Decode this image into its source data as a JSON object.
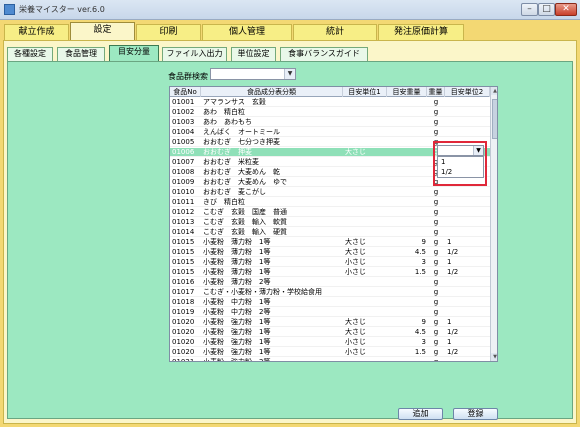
{
  "window": {
    "title": "栄養マイスター ver.6.0"
  },
  "main_tabs": [
    "献立作成",
    "設定",
    "印刷",
    "個人管理",
    "統計",
    "発注原価計算"
  ],
  "sub_tabs": [
    "各種設定",
    "食品管理",
    "目安分量",
    "ファイル入出力",
    "単位設定",
    "食事バランスガイド"
  ],
  "search": {
    "label": "食品群検索",
    "value": ""
  },
  "table": {
    "headers": [
      "食品No",
      "食品成分表分類",
      "目安単位1",
      "目安重量",
      "重量",
      "目安単位2"
    ],
    "rows": [
      {
        "no": "01001",
        "name": "アマランサス　玄穀",
        "u1": "",
        "q": "",
        "w": "g",
        "u2": ""
      },
      {
        "no": "01002",
        "name": "あわ　精白粒",
        "u1": "",
        "q": "",
        "w": "g",
        "u2": ""
      },
      {
        "no": "01003",
        "name": "あわ　あわもち",
        "u1": "",
        "q": "",
        "w": "g",
        "u2": ""
      },
      {
        "no": "01004",
        "name": "えんばく　オートミール",
        "u1": "",
        "q": "",
        "w": "g",
        "u2": ""
      },
      {
        "no": "01005",
        "name": "おおむぎ　七分つき押麦",
        "u1": "",
        "q": "",
        "w": "g",
        "u2": ""
      },
      {
        "no": "01006",
        "name": "おおむぎ　押麦",
        "u1": "大さじ",
        "q": "",
        "w": "g",
        "u2": "",
        "selected": true
      },
      {
        "no": "01007",
        "name": "おおむぎ　米粒麦",
        "u1": "",
        "q": "",
        "w": "g",
        "u2": ""
      },
      {
        "no": "01008",
        "name": "おおむぎ　大麦めん　乾",
        "u1": "",
        "q": "",
        "w": "g",
        "u2": ""
      },
      {
        "no": "01009",
        "name": "おおむぎ　大麦めん　ゆで",
        "u1": "",
        "q": "",
        "w": "g",
        "u2": ""
      },
      {
        "no": "01010",
        "name": "おおむぎ　麦こがし",
        "u1": "",
        "q": "",
        "w": "g",
        "u2": ""
      },
      {
        "no": "01011",
        "name": "きび　精白粒",
        "u1": "",
        "q": "",
        "w": "g",
        "u2": ""
      },
      {
        "no": "01012",
        "name": "こむぎ　玄穀　国産　普通",
        "u1": "",
        "q": "",
        "w": "g",
        "u2": ""
      },
      {
        "no": "01013",
        "name": "こむぎ　玄穀　輸入　軟質",
        "u1": "",
        "q": "",
        "w": "g",
        "u2": ""
      },
      {
        "no": "01014",
        "name": "こむぎ　玄穀　輸入　硬質",
        "u1": "",
        "q": "",
        "w": "g",
        "u2": ""
      },
      {
        "no": "01015",
        "name": "小麦粉　薄力粉　1等",
        "u1": "大さじ",
        "q": "9",
        "w": "g",
        "u2": "1"
      },
      {
        "no": "01015",
        "name": "小麦粉　薄力粉　1等",
        "u1": "大さじ",
        "q": "4.5",
        "w": "g",
        "u2": "1/2"
      },
      {
        "no": "01015",
        "name": "小麦粉　薄力粉　1等",
        "u1": "小さじ",
        "q": "3",
        "w": "g",
        "u2": "1"
      },
      {
        "no": "01015",
        "name": "小麦粉　薄力粉　1等",
        "u1": "小さじ",
        "q": "1.5",
        "w": "g",
        "u2": "1/2"
      },
      {
        "no": "01016",
        "name": "小麦粉　薄力粉　2等",
        "u1": "",
        "q": "",
        "w": "g",
        "u2": ""
      },
      {
        "no": "01017",
        "name": "こむぎ・小麦粉・薄力粉・学校給食用",
        "u1": "",
        "q": "",
        "w": "g",
        "u2": ""
      },
      {
        "no": "01018",
        "name": "小麦粉　中力粉　1等",
        "u1": "",
        "q": "",
        "w": "g",
        "u2": ""
      },
      {
        "no": "01019",
        "name": "小麦粉　中力粉　2等",
        "u1": "",
        "q": "",
        "w": "g",
        "u2": ""
      },
      {
        "no": "01020",
        "name": "小麦粉　強力粉　1等",
        "u1": "大さじ",
        "q": "9",
        "w": "g",
        "u2": "1"
      },
      {
        "no": "01020",
        "name": "小麦粉　強力粉　1等",
        "u1": "大さじ",
        "q": "4.5",
        "w": "g",
        "u2": "1/2"
      },
      {
        "no": "01020",
        "name": "小麦粉　強力粉　1等",
        "u1": "小さじ",
        "q": "3",
        "w": "g",
        "u2": "1"
      },
      {
        "no": "01020",
        "name": "小麦粉　強力粉　1等",
        "u1": "小さじ",
        "q": "1.5",
        "w": "g",
        "u2": "1/2"
      },
      {
        "no": "01021",
        "name": "小麦粉　強力粉　2等",
        "u1": "",
        "q": "",
        "w": "g",
        "u2": ""
      }
    ]
  },
  "dropdown": {
    "options": [
      "1",
      "1/2"
    ]
  },
  "buttons": {
    "add": "追加",
    "register": "登録"
  },
  "colors": {
    "window_bg": "#f3d873",
    "content_bg": "#9ce8c1",
    "highlight": "#e0283a"
  }
}
